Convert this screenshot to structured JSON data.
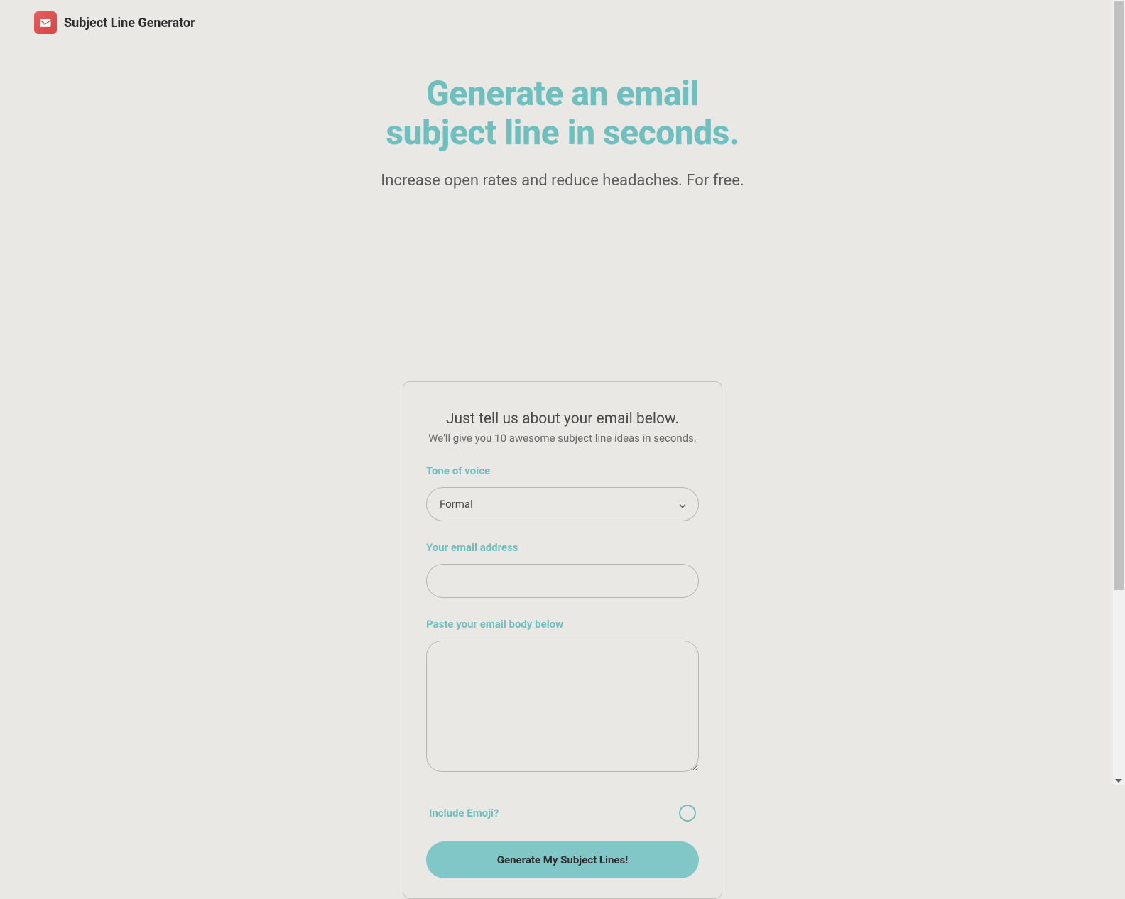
{
  "header": {
    "app_title": "Subject Line Generator"
  },
  "hero": {
    "title_line1": "Generate an email",
    "title_line2": "subject line in seconds.",
    "subtitle": "Increase open rates and reduce headaches. For free."
  },
  "form": {
    "heading": "Just tell us about your email below.",
    "subheading": "We'll give you 10 awesome subject line ideas in seconds.",
    "tone_label": "Tone of voice",
    "tone_value": "Formal",
    "email_label": "Your email address",
    "email_value": "",
    "body_label": "Paste your email body below",
    "body_value": "",
    "emoji_label": "Include Emoji?",
    "emoji_checked": false,
    "generate_button": "Generate My Subject Lines!"
  },
  "colors": {
    "accent": "#6fbfbf",
    "background": "#eae8e4",
    "text_dark": "#2d2d2d",
    "text_medium": "#4a4a4a",
    "border": "#b8b6b2"
  }
}
